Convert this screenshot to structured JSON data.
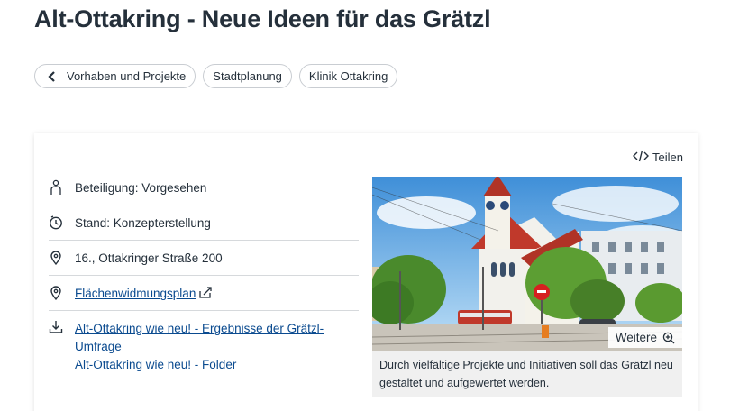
{
  "page": {
    "title": "Alt-Ottakring - Neue Ideen für das Grätzl"
  },
  "breadcrumbs": [
    {
      "label": "Vorhaben und Projekte",
      "icon": "chevron-left-icon"
    },
    {
      "label": "Stadtplanung"
    },
    {
      "label": "Klinik Ottakring"
    }
  ],
  "share": {
    "label": "Teilen",
    "icon": "code-icon"
  },
  "info": {
    "participation": "Beteiligung: Vorgesehen",
    "status": "Stand: Konzepterstellung",
    "address": "16., Ottakringer Straße 200",
    "zoning_link": "Flächenwidmungsplan",
    "downloads": [
      "Alt-Ottakring wie neu! - Ergebnisse der Grätzl-Umfrage",
      "Alt-Ottakring wie neu! - Folder"
    ]
  },
  "media": {
    "more_label": "Weitere",
    "caption": "Durch vielfältige Projekte und Initiativen soll das Grätzl neu gestaltet und aufgewertet werden."
  },
  "colors": {
    "text": "#25303b",
    "link": "#0a4a8f",
    "chip_border": "#c9cdd2",
    "caption_bg": "#f0f0f0"
  }
}
